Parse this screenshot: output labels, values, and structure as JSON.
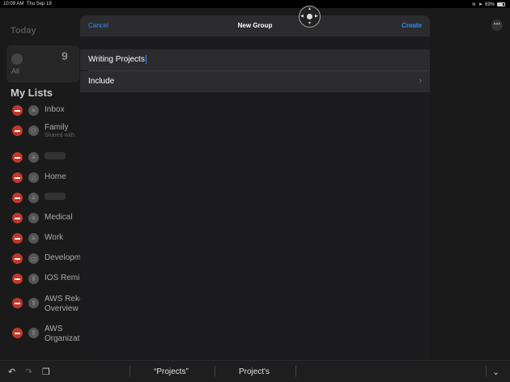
{
  "status_bar": {
    "time": "10:09 AM",
    "date": "Thu Sep 19",
    "battery": "69%"
  },
  "background": {
    "section_title": "Today",
    "all_card": {
      "count": "9",
      "label": "All"
    },
    "my_lists_title": "My Lists",
    "lists": [
      {
        "name": "Inbox",
        "subtitle": "",
        "icon": "list-icon"
      },
      {
        "name": "Family",
        "subtitle": "Shared with",
        "icon": "people-icon"
      },
      {
        "name": "",
        "subtitle": "",
        "icon": "list-icon",
        "redacted": true
      },
      {
        "name": "Home",
        "subtitle": "",
        "icon": "house-icon"
      },
      {
        "name": "",
        "subtitle": "",
        "icon": "list-icon",
        "redacted": true
      },
      {
        "name": "Medical",
        "subtitle": "",
        "icon": "list-icon"
      },
      {
        "name": "Work",
        "subtitle": "",
        "icon": "list-icon"
      },
      {
        "name": "Developm",
        "subtitle": "",
        "icon": "desktop-icon"
      },
      {
        "name": "IOS Remi",
        "subtitle": "",
        "icon": "pause-icon"
      },
      {
        "name": "AWS Reko",
        "subtitle": "Overview",
        "icon": "pause-icon"
      },
      {
        "name": "AWS",
        "subtitle": "Organizat",
        "icon": "pause-icon"
      }
    ]
  },
  "modal": {
    "cancel_label": "Cancel",
    "title": "New Group",
    "create_label": "Create",
    "name_value": "Writing Projects",
    "include_label": "Include"
  },
  "keyboard_bar": {
    "suggestions": [
      "“Projects”",
      "Project's"
    ]
  },
  "colors": {
    "accent": "#2f8cff",
    "delete": "#c0392b",
    "modal_bg": "#1c1c1e",
    "row_bg": "#2c2c2e"
  }
}
